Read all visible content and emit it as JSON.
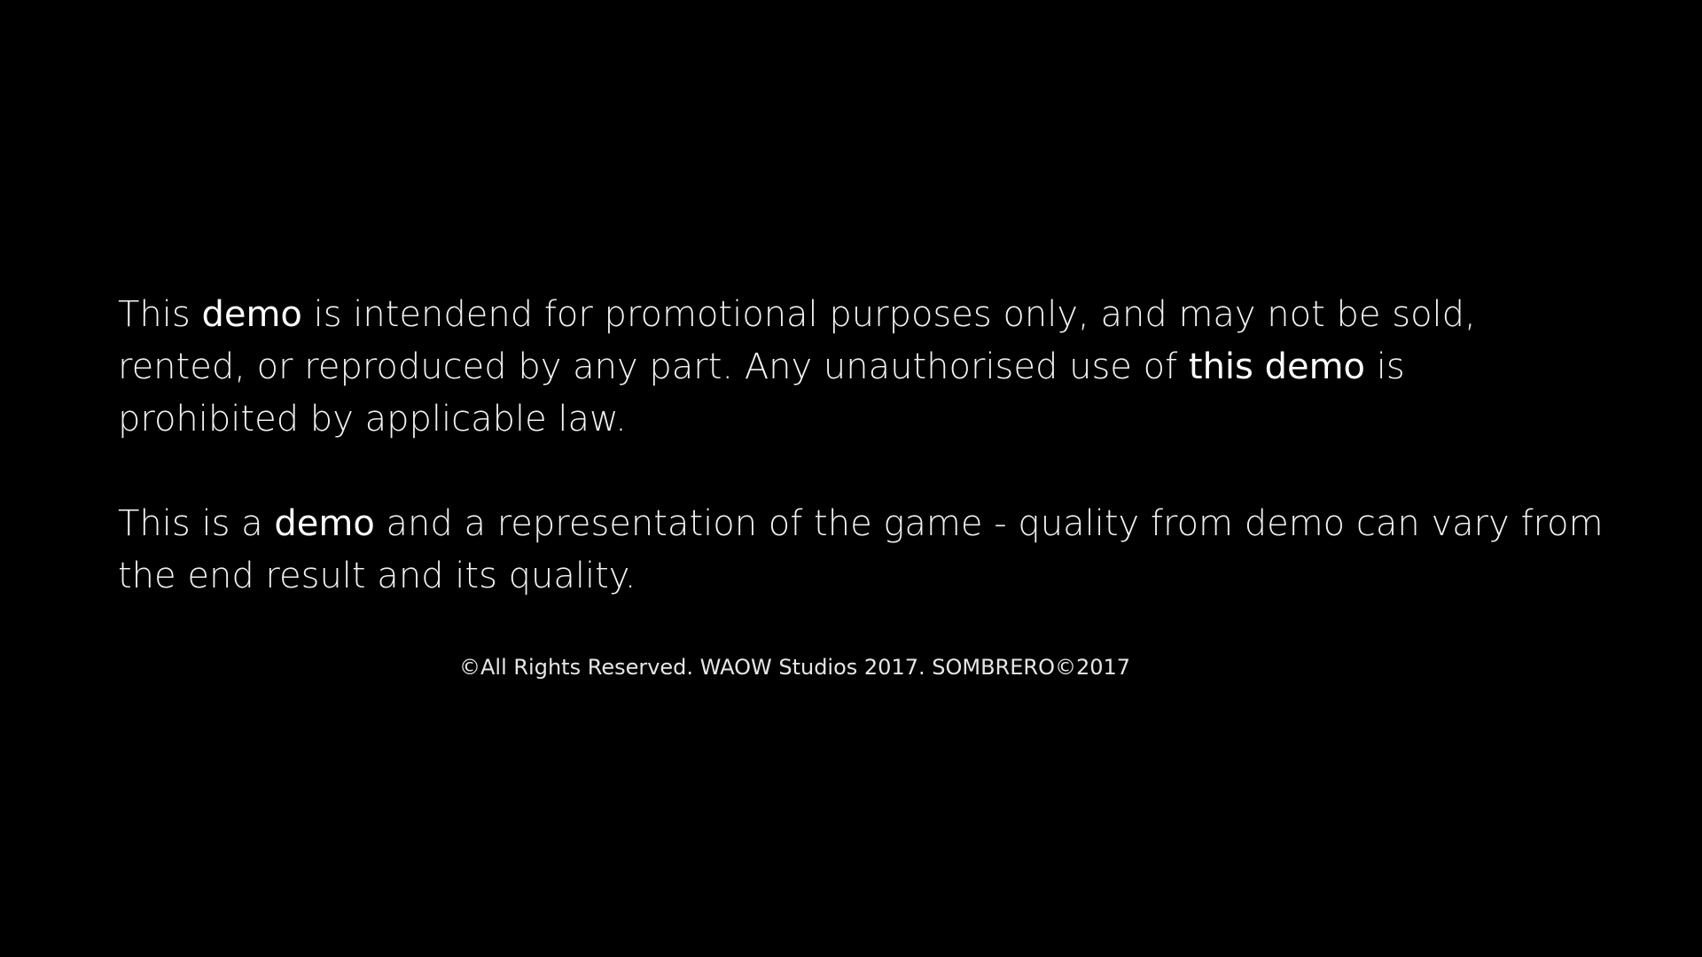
{
  "colors": {
    "background": "#000000",
    "text": "#f2f2f2",
    "emphasis": "#ffffff"
  },
  "disclaimer": {
    "paragraph1": {
      "line1": {
        "a": "This ",
        "b": "demo",
        "c": " is intendend for promotional purposes only, and may not be sold,"
      },
      "line2": {
        "a": "rented, or reproduced by any part. Any unauthorised use of ",
        "b": "this demo",
        "c": " is"
      },
      "line3": {
        "a": "prohibited by applicable law."
      }
    },
    "paragraph2": {
      "line1": {
        "a": "This is a ",
        "b": "demo",
        "c": " and a representation of the game - quality from demo can vary from"
      },
      "line2": {
        "a": "the end result and its quality."
      }
    }
  },
  "copyright": "©All Rights Reserved. WAOW Studios 2017. SOMBRERO©2017"
}
